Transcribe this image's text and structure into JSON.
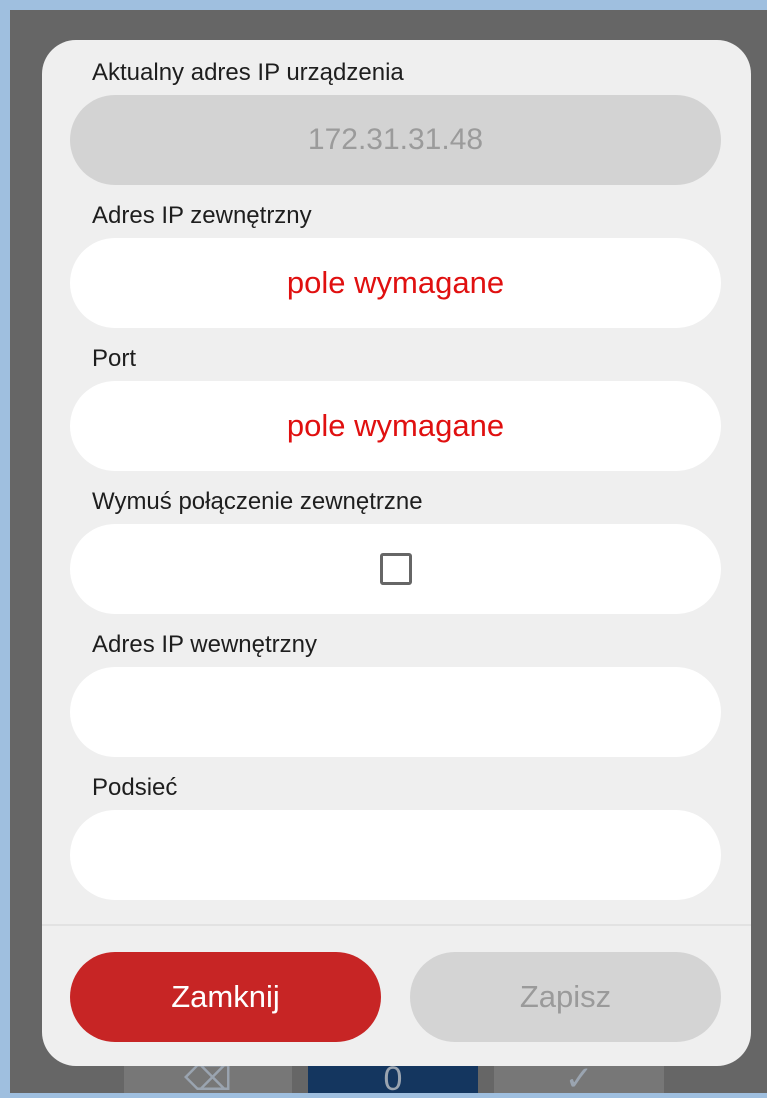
{
  "dialog": {
    "current_ip": {
      "label": "Aktualny adres IP urządzenia",
      "value": "172.31.31.48"
    },
    "external_ip": {
      "label": "Adres IP zewnętrzny",
      "placeholder": "pole wymagane"
    },
    "port": {
      "label": "Port",
      "placeholder": "pole wymagane"
    },
    "force_external": {
      "label": "Wymuś połączenie zewnętrzne",
      "checked": false
    },
    "internal_ip": {
      "label": "Adres IP wewnętrzny",
      "value": ""
    },
    "subnet": {
      "label": "Podsieć",
      "value": ""
    },
    "buttons": {
      "close_label": "Zamknij",
      "save_label": "Zapisz"
    }
  },
  "background_keys": [
    "⌫",
    "0",
    "✓"
  ],
  "colors": {
    "required_text": "#e01010",
    "close_button": "#c72525",
    "save_button_disabled": "#d4d4d4"
  }
}
